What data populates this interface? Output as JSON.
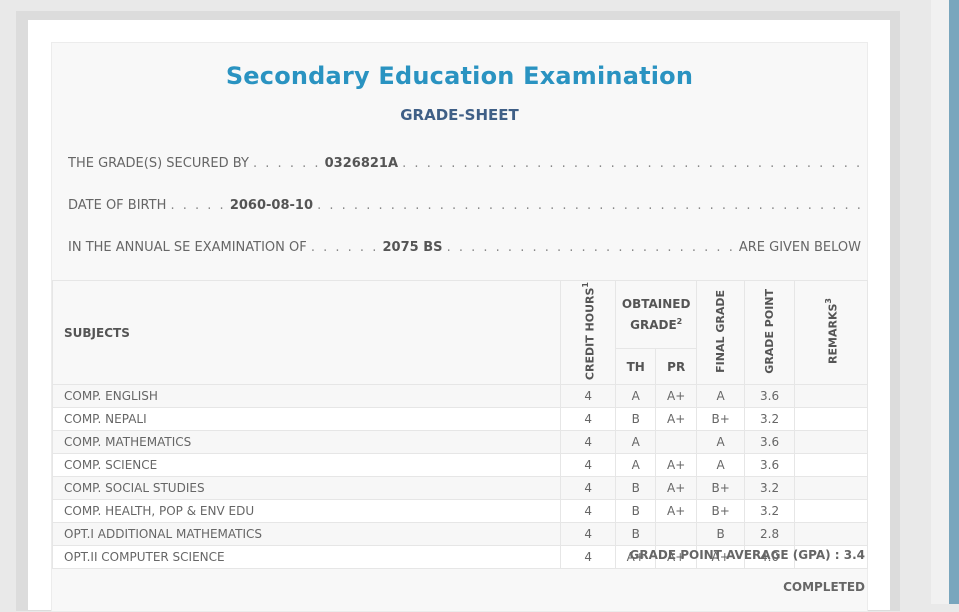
{
  "header": {
    "title": "Secondary Education Examination",
    "subtitle": "GRADE-SHEET"
  },
  "lines": {
    "secured_label": "THE GRADE(S) SECURED BY",
    "lead_dots": ". . . . . .",
    "short_dots": ". . . . .",
    "symbol_no": "0326821A",
    "dob_label": "DATE OF BIRTH",
    "dob": "2060-08-10",
    "exam_label": "IN THE ANNUAL SE EXAMINATION OF",
    "exam_year": "2075 BS",
    "given_below": "ARE GIVEN BELOW",
    "long_dots": ". . . . . . . . . . . . . . . . . . . . . . . . . . . . . . . . . . . . . . . . . . . . . . . . . . . . . . . . . . . . . . . . . . . . . . . . . . . . . . . . . ."
  },
  "table": {
    "headers": {
      "subjects": "SUBJECTS",
      "credit_hours": "CREDIT HOURS",
      "credit_sup": "1",
      "obtained_grade": "OBTAINED GRADE",
      "obtained_sup": "2",
      "th": "TH",
      "pr": "PR",
      "final_grade": "FINAL GRADE",
      "grade_point": "GRADE POINT",
      "remarks": "REMARKS",
      "remarks_sup": "3"
    },
    "rows": [
      {
        "subject": "COMP. ENGLISH",
        "credit": "4",
        "th": "A",
        "pr": "A+",
        "final": "A",
        "gp": "3.6",
        "remarks": ""
      },
      {
        "subject": "COMP. NEPALI",
        "credit": "4",
        "th": "B",
        "pr": "A+",
        "final": "B+",
        "gp": "3.2",
        "remarks": ""
      },
      {
        "subject": "COMP. MATHEMATICS",
        "credit": "4",
        "th": "A",
        "pr": "",
        "final": "A",
        "gp": "3.6",
        "remarks": ""
      },
      {
        "subject": "COMP. SCIENCE",
        "credit": "4",
        "th": "A",
        "pr": "A+",
        "final": "A",
        "gp": "3.6",
        "remarks": ""
      },
      {
        "subject": "COMP. SOCIAL STUDIES",
        "credit": "4",
        "th": "B",
        "pr": "A+",
        "final": "B+",
        "gp": "3.2",
        "remarks": ""
      },
      {
        "subject": "COMP. HEALTH, POP & ENV EDU",
        "credit": "4",
        "th": "B",
        "pr": "A+",
        "final": "B+",
        "gp": "3.2",
        "remarks": ""
      },
      {
        "subject": "OPT.I ADDITIONAL MATHEMATICS",
        "credit": "4",
        "th": "B",
        "pr": "",
        "final": "B",
        "gp": "2.8",
        "remarks": ""
      },
      {
        "subject": "OPT.II COMPUTER SCIENCE",
        "credit": "4",
        "th": "A+",
        "pr": "A+",
        "final": "A+",
        "gp": "4.0",
        "remarks": ""
      }
    ]
  },
  "summary": {
    "gpa_text": "GRADE POINT AVERAGE (GPA) : 3.4",
    "status": "COMPLETED"
  },
  "colors": {
    "title": "#2a93c1",
    "subtitle": "#3f5f86",
    "accent_bar": "#79a6bd"
  }
}
